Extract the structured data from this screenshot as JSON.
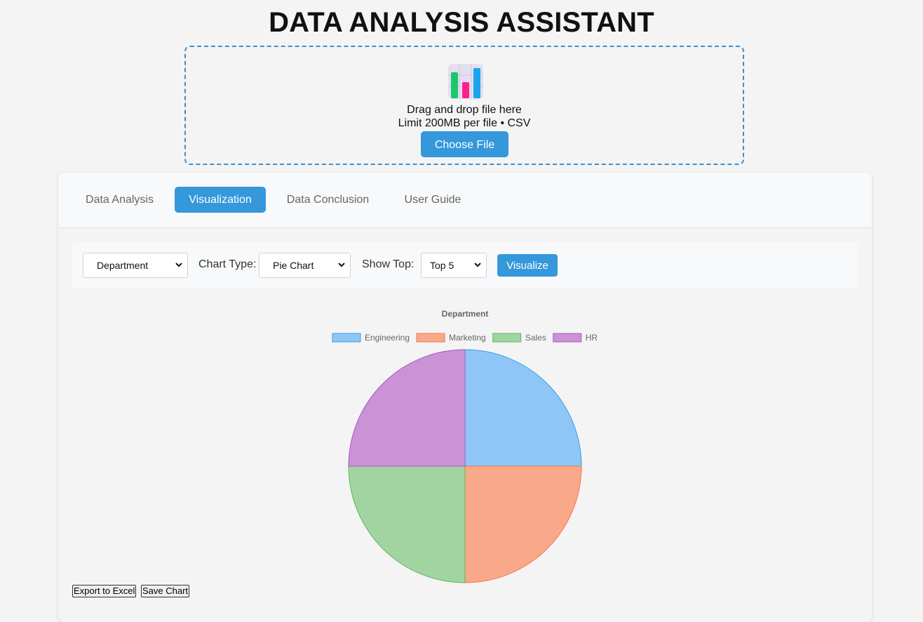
{
  "app": {
    "title": "DATA ANALYSIS ASSISTANT"
  },
  "upload": {
    "line1": "Drag and drop file here",
    "line2": "Limit 200MB per file • CSV",
    "button_label": "Choose File"
  },
  "tabs": [
    {
      "label": "Data Analysis",
      "active": false
    },
    {
      "label": "Visualization",
      "active": true
    },
    {
      "label": "Data Conclusion",
      "active": false
    },
    {
      "label": "User Guide",
      "active": false
    }
  ],
  "controls": {
    "column_select": "Department",
    "chart_type_label": "Chart Type:",
    "chart_type_select": "Pie Chart",
    "show_top_label": "Show Top:",
    "show_top_select": "Top 5",
    "visualize_label": "Visualize"
  },
  "actions": {
    "export_label": "Export to Excel",
    "save_label": "Save Chart"
  },
  "colors": {
    "accent": "#3498db",
    "series": [
      {
        "fill": "#8ec6f5",
        "stroke": "#3a9ee8"
      },
      {
        "fill": "#f9a98a",
        "stroke": "#f2764d"
      },
      {
        "fill": "#a2d4a2",
        "stroke": "#5cb85c"
      },
      {
        "fill": "#c993d6",
        "stroke": "#a85bc0"
      }
    ]
  },
  "chart_data": {
    "type": "pie",
    "title": "Department",
    "legend_position": "top",
    "categories": [
      "Engineering",
      "Marketing",
      "Sales",
      "HR"
    ],
    "values": [
      1,
      1,
      1,
      1
    ]
  }
}
